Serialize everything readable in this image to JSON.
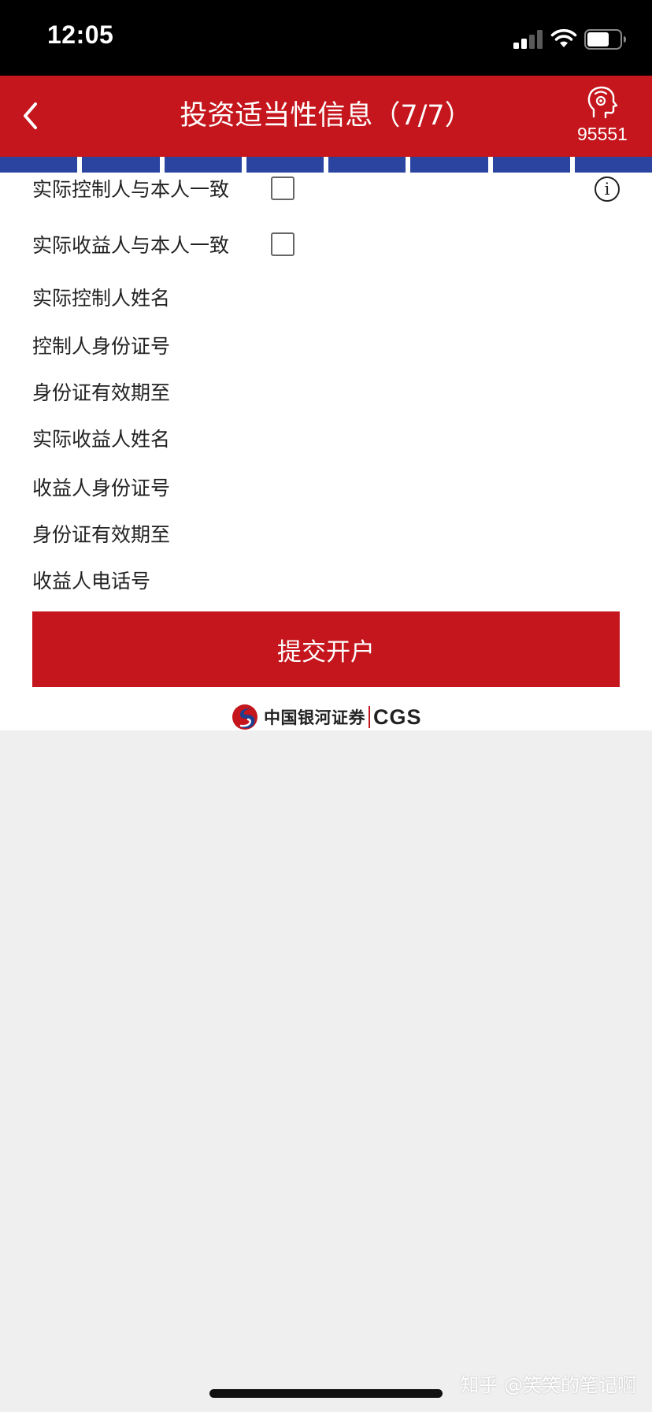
{
  "status_bar": {
    "time": "12:05"
  },
  "nav": {
    "title": "投资适当性信息（7/7）",
    "service_number": "95551"
  },
  "progress": {
    "segments": 8,
    "completed": 8
  },
  "form": {
    "rows": [
      {
        "label": "实际控制人与本人一致",
        "checked": false
      },
      {
        "label": "实际收益人与本人一致",
        "checked": false
      },
      {
        "label": "实际控制人姓名"
      },
      {
        "label": "控制人身份证号"
      },
      {
        "label": "身份证有效期至"
      },
      {
        "label": "实际收益人姓名"
      },
      {
        "label": "收益人身份证号"
      },
      {
        "label": "身份证有效期至"
      },
      {
        "label": "收益人电话号"
      }
    ],
    "submit_label": "提交开户"
  },
  "brand": {
    "name_cn": "中国银河证券",
    "name_en": "CGS"
  },
  "watermark": "知乎 @笑笑的笔记啊",
  "colors": {
    "brand_red": "#c4161c",
    "progress_blue": "#2a44a0",
    "page_bg": "#efefef"
  }
}
